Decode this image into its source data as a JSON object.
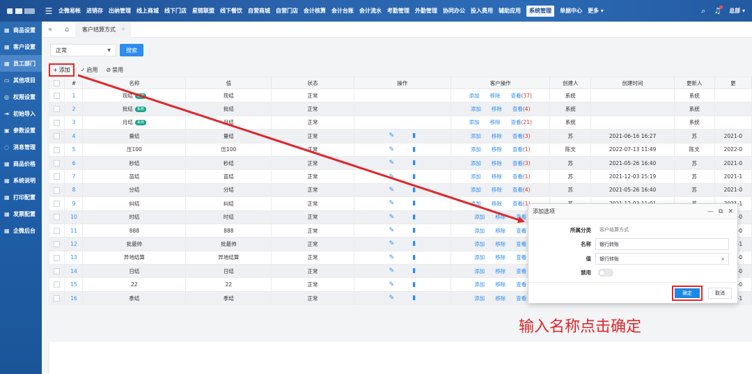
{
  "colors": {
    "accent": "#2d8cf0",
    "annotation": "#e0262a",
    "badge": "#19a38a",
    "nav_bg": "#2a64ad"
  },
  "topbar": {
    "nav": [
      "企微易帐",
      "进销存",
      "出纳管理",
      "线上商城",
      "线下门店",
      "星链联盟",
      "线下餐饮",
      "自营商城",
      "自营门店",
      "会计核算",
      "会计台账",
      "会计流水",
      "考勤管理",
      "外勤管理",
      "协同办公",
      "投入费用",
      "辅助应用",
      "系统管理",
      "单据中心"
    ],
    "active_index": 17,
    "more": "更多 ▾",
    "user": "总部 ▾"
  },
  "sidebar": {
    "items": [
      {
        "label": "商品设置",
        "icon": "grid-icon"
      },
      {
        "label": "客户设置",
        "icon": "grid-icon"
      },
      {
        "label": "员工部门",
        "icon": "grid-icon"
      },
      {
        "label": "其他项目",
        "icon": "folder-icon"
      },
      {
        "label": "权限设置",
        "icon": "shield-icon"
      },
      {
        "label": "初始导入",
        "icon": "import-icon"
      },
      {
        "label": "参数设置",
        "icon": "settings-icon"
      },
      {
        "label": "消息管理",
        "icon": "message-icon"
      },
      {
        "label": "商品价格",
        "icon": "grid-icon"
      },
      {
        "label": "系统说明",
        "icon": "grid-icon"
      },
      {
        "label": "打印配置",
        "icon": "grid-icon"
      },
      {
        "label": "发票配置",
        "icon": "grid-icon"
      },
      {
        "label": "企微后台",
        "icon": "grid-icon"
      }
    ],
    "active_index": 2
  },
  "tabs": {
    "current": "客户结算方式"
  },
  "filter": {
    "status_value": "正常",
    "search_label": "搜索"
  },
  "toolbar": {
    "add": "添加",
    "enable": "启用",
    "disable": "禁用"
  },
  "table": {
    "headers": [
      "#",
      "名称",
      "值",
      "状态",
      "操作",
      "客户操作",
      "创建人",
      "创建时间",
      "更新人",
      "更"
    ],
    "badge": "系统",
    "cust_ops": {
      "add": "添加",
      "remove": "移除",
      "view": "查看"
    },
    "rows": [
      {
        "idx": "1",
        "name": "现结",
        "system": true,
        "value": "现结",
        "status": "正常",
        "editable": false,
        "count": "(37)",
        "creator": "系统",
        "created": "",
        "updater": "系统",
        "more": ""
      },
      {
        "idx": "2",
        "name": "批结",
        "system": true,
        "value": "批结",
        "status": "正常",
        "editable": false,
        "count": "(4)",
        "creator": "系统",
        "created": "",
        "updater": "系统",
        "more": ""
      },
      {
        "idx": "3",
        "name": "月结",
        "system": true,
        "value": "月结",
        "status": "正常",
        "editable": false,
        "count": "(21)",
        "creator": "系统",
        "created": "",
        "updater": "系统",
        "more": ""
      },
      {
        "idx": "4",
        "name": "量结",
        "system": false,
        "value": "量结",
        "status": "正常",
        "editable": true,
        "count": "(3)",
        "creator": "苏",
        "created": "2021-06-16 16:27",
        "updater": "苏",
        "more": "2021-0"
      },
      {
        "idx": "5",
        "name": "压100",
        "system": false,
        "value": "压100",
        "status": "正常",
        "editable": true,
        "count": "(1)",
        "creator": "陈文",
        "created": "2022-07-13 11:49",
        "updater": "陈文",
        "more": "2022-0"
      },
      {
        "idx": "6",
        "name": "秒结",
        "system": false,
        "value": "秒结",
        "status": "正常",
        "editable": true,
        "count": "(3)",
        "creator": "苏",
        "created": "2021-05-26 16:40",
        "updater": "苏",
        "more": "2021-0"
      },
      {
        "idx": "7",
        "name": "苗结",
        "system": false,
        "value": "苗结",
        "status": "正常",
        "editable": true,
        "count": "(1)",
        "creator": "苏",
        "created": "2021-12-03 15:19",
        "updater": "苏",
        "more": "2021-1"
      },
      {
        "idx": "8",
        "name": "分结",
        "system": false,
        "value": "分结",
        "status": "正常",
        "editable": true,
        "count": "(4)",
        "creator": "苏",
        "created": "2021-05-26 16:40",
        "updater": "苏",
        "more": "2021-0"
      },
      {
        "idx": "9",
        "name": "纠结",
        "system": false,
        "value": "纠结",
        "status": "正常",
        "editable": true,
        "count": "(1)",
        "creator": "苏",
        "created": "2021-12-03 11:01",
        "updater": "苏",
        "more": "2021-1"
      },
      {
        "idx": "10",
        "name": "时结",
        "system": false,
        "value": "时结",
        "status": "正常",
        "editable": true,
        "count": "",
        "creator": "",
        "created": "",
        "updater": "",
        "more": "2021-0"
      },
      {
        "idx": "11",
        "name": "888",
        "system": false,
        "value": "888",
        "status": "正常",
        "editable": true,
        "count": "",
        "creator": "",
        "created": "",
        "updater": "",
        "more": "2021-0"
      },
      {
        "idx": "12",
        "name": "批最帅",
        "system": false,
        "value": "批最帅",
        "status": "正常",
        "editable": true,
        "count": "",
        "creator": "",
        "created": "",
        "updater": "",
        "more": "2021-1"
      },
      {
        "idx": "13",
        "name": "异地结算",
        "system": false,
        "value": "异地结算",
        "status": "正常",
        "editable": true,
        "count": "",
        "creator": "",
        "created": "",
        "updater": "",
        "more": "2022-0"
      },
      {
        "idx": "14",
        "name": "日结",
        "system": false,
        "value": "日结",
        "status": "正常",
        "editable": true,
        "count": "",
        "creator": "",
        "created": "",
        "updater": "",
        "more": "2021-0"
      },
      {
        "idx": "15",
        "name": "22",
        "system": false,
        "value": "22",
        "status": "正常",
        "editable": true,
        "count": "",
        "creator": "",
        "created": "",
        "updater": "",
        "more": "2022-0"
      },
      {
        "idx": "16",
        "name": "季结",
        "system": false,
        "value": "季结",
        "status": "正常",
        "editable": true,
        "count": "",
        "creator": "",
        "created": "",
        "updater": "",
        "more": "2021-1"
      }
    ]
  },
  "dialog": {
    "title": "添加选项",
    "category_label": "所属分类",
    "category_value": "客户结算方式",
    "name_label": "名称",
    "name_value": "银行转账",
    "value_label": "值",
    "value_value": "银行转账",
    "disabled_label": "禁用",
    "ok": "确定",
    "cancel": "取消"
  },
  "annotation": "输入名称点击确定"
}
